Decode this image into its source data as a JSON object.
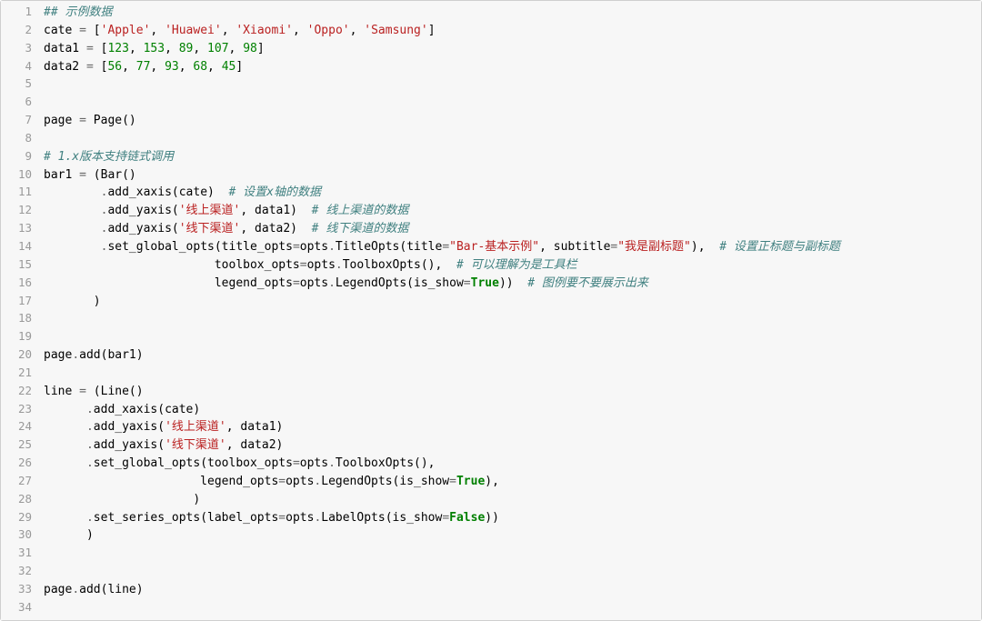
{
  "lines": [
    {
      "n": "1",
      "tokens": [
        {
          "c": "tok-comment",
          "t": "## 示例数据"
        }
      ]
    },
    {
      "n": "2",
      "tokens": [
        {
          "c": "",
          "t": "cate "
        },
        {
          "c": "tok-op",
          "t": "="
        },
        {
          "c": "",
          "t": " ["
        },
        {
          "c": "tok-str",
          "t": "'Apple'"
        },
        {
          "c": "",
          "t": ", "
        },
        {
          "c": "tok-str",
          "t": "'Huawei'"
        },
        {
          "c": "",
          "t": ", "
        },
        {
          "c": "tok-str",
          "t": "'Xiaomi'"
        },
        {
          "c": "",
          "t": ", "
        },
        {
          "c": "tok-str",
          "t": "'Oppo'"
        },
        {
          "c": "",
          "t": ", "
        },
        {
          "c": "tok-str",
          "t": "'Samsung'"
        },
        {
          "c": "",
          "t": "]"
        }
      ]
    },
    {
      "n": "3",
      "tokens": [
        {
          "c": "",
          "t": "data1 "
        },
        {
          "c": "tok-op",
          "t": "="
        },
        {
          "c": "",
          "t": " ["
        },
        {
          "c": "tok-num",
          "t": "123"
        },
        {
          "c": "",
          "t": ", "
        },
        {
          "c": "tok-num",
          "t": "153"
        },
        {
          "c": "",
          "t": ", "
        },
        {
          "c": "tok-num",
          "t": "89"
        },
        {
          "c": "",
          "t": ", "
        },
        {
          "c": "tok-num",
          "t": "107"
        },
        {
          "c": "",
          "t": ", "
        },
        {
          "c": "tok-num",
          "t": "98"
        },
        {
          "c": "",
          "t": "]"
        }
      ]
    },
    {
      "n": "4",
      "tokens": [
        {
          "c": "",
          "t": "data2 "
        },
        {
          "c": "tok-op",
          "t": "="
        },
        {
          "c": "",
          "t": " ["
        },
        {
          "c": "tok-num",
          "t": "56"
        },
        {
          "c": "",
          "t": ", "
        },
        {
          "c": "tok-num",
          "t": "77"
        },
        {
          "c": "",
          "t": ", "
        },
        {
          "c": "tok-num",
          "t": "93"
        },
        {
          "c": "",
          "t": ", "
        },
        {
          "c": "tok-num",
          "t": "68"
        },
        {
          "c": "",
          "t": ", "
        },
        {
          "c": "tok-num",
          "t": "45"
        },
        {
          "c": "",
          "t": "]"
        }
      ]
    },
    {
      "n": "5",
      "tokens": []
    },
    {
      "n": "6",
      "tokens": []
    },
    {
      "n": "7",
      "tokens": [
        {
          "c": "",
          "t": "page "
        },
        {
          "c": "tok-op",
          "t": "="
        },
        {
          "c": "",
          "t": " Page()"
        }
      ]
    },
    {
      "n": "8",
      "tokens": []
    },
    {
      "n": "9",
      "tokens": [
        {
          "c": "tok-comment",
          "t": "# 1.x版本支持链式调用"
        }
      ]
    },
    {
      "n": "10",
      "tokens": [
        {
          "c": "",
          "t": "bar1 "
        },
        {
          "c": "tok-op",
          "t": "="
        },
        {
          "c": "",
          "t": " (Bar()"
        }
      ]
    },
    {
      "n": "11",
      "tokens": [
        {
          "c": "",
          "t": "        "
        },
        {
          "c": "tok-op",
          "t": "."
        },
        {
          "c": "",
          "t": "add_xaxis(cate)  "
        },
        {
          "c": "tok-comment",
          "t": "# 设置x轴的数据"
        }
      ]
    },
    {
      "n": "12",
      "tokens": [
        {
          "c": "",
          "t": "        "
        },
        {
          "c": "tok-op",
          "t": "."
        },
        {
          "c": "",
          "t": "add_yaxis("
        },
        {
          "c": "tok-str",
          "t": "'线上渠道'"
        },
        {
          "c": "",
          "t": ", data1)  "
        },
        {
          "c": "tok-comment",
          "t": "# 线上渠道的数据"
        }
      ]
    },
    {
      "n": "13",
      "tokens": [
        {
          "c": "",
          "t": "        "
        },
        {
          "c": "tok-op",
          "t": "."
        },
        {
          "c": "",
          "t": "add_yaxis("
        },
        {
          "c": "tok-str",
          "t": "'线下渠道'"
        },
        {
          "c": "",
          "t": ", data2)  "
        },
        {
          "c": "tok-comment",
          "t": "# 线下渠道的数据"
        }
      ]
    },
    {
      "n": "14",
      "tokens": [
        {
          "c": "",
          "t": "        "
        },
        {
          "c": "tok-op",
          "t": "."
        },
        {
          "c": "",
          "t": "set_global_opts(title_opts"
        },
        {
          "c": "tok-op",
          "t": "="
        },
        {
          "c": "",
          "t": "opts"
        },
        {
          "c": "tok-op",
          "t": "."
        },
        {
          "c": "",
          "t": "TitleOpts(title"
        },
        {
          "c": "tok-op",
          "t": "="
        },
        {
          "c": "tok-str",
          "t": "\"Bar-基本示例\""
        },
        {
          "c": "",
          "t": ", subtitle"
        },
        {
          "c": "tok-op",
          "t": "="
        },
        {
          "c": "tok-str",
          "t": "\"我是副标题\""
        },
        {
          "c": "",
          "t": "),  "
        },
        {
          "c": "tok-comment",
          "t": "# 设置正标题与副标题"
        }
      ]
    },
    {
      "n": "15",
      "tokens": [
        {
          "c": "",
          "t": "                        toolbox_opts"
        },
        {
          "c": "tok-op",
          "t": "="
        },
        {
          "c": "",
          "t": "opts"
        },
        {
          "c": "tok-op",
          "t": "."
        },
        {
          "c": "",
          "t": "ToolboxOpts(),  "
        },
        {
          "c": "tok-comment",
          "t": "# 可以理解为是工具栏"
        }
      ]
    },
    {
      "n": "16",
      "tokens": [
        {
          "c": "",
          "t": "                        legend_opts"
        },
        {
          "c": "tok-op",
          "t": "="
        },
        {
          "c": "",
          "t": "opts"
        },
        {
          "c": "tok-op",
          "t": "."
        },
        {
          "c": "",
          "t": "LegendOpts(is_show"
        },
        {
          "c": "tok-op",
          "t": "="
        },
        {
          "c": "tok-kw",
          "t": "True"
        },
        {
          "c": "",
          "t": "))  "
        },
        {
          "c": "tok-comment",
          "t": "# 图例要不要展示出来"
        }
      ]
    },
    {
      "n": "17",
      "tokens": [
        {
          "c": "",
          "t": "       )"
        }
      ]
    },
    {
      "n": "18",
      "tokens": []
    },
    {
      "n": "19",
      "tokens": []
    },
    {
      "n": "20",
      "tokens": [
        {
          "c": "",
          "t": "page"
        },
        {
          "c": "tok-op",
          "t": "."
        },
        {
          "c": "",
          "t": "add(bar1)"
        }
      ]
    },
    {
      "n": "21",
      "tokens": []
    },
    {
      "n": "22",
      "tokens": [
        {
          "c": "",
          "t": "line "
        },
        {
          "c": "tok-op",
          "t": "="
        },
        {
          "c": "",
          "t": " (Line()"
        }
      ]
    },
    {
      "n": "23",
      "tokens": [
        {
          "c": "",
          "t": "      "
        },
        {
          "c": "tok-op",
          "t": "."
        },
        {
          "c": "",
          "t": "add_xaxis(cate)"
        }
      ]
    },
    {
      "n": "24",
      "tokens": [
        {
          "c": "",
          "t": "      "
        },
        {
          "c": "tok-op",
          "t": "."
        },
        {
          "c": "",
          "t": "add_yaxis("
        },
        {
          "c": "tok-str",
          "t": "'线上渠道'"
        },
        {
          "c": "",
          "t": ", data1)"
        }
      ]
    },
    {
      "n": "25",
      "tokens": [
        {
          "c": "",
          "t": "      "
        },
        {
          "c": "tok-op",
          "t": "."
        },
        {
          "c": "",
          "t": "add_yaxis("
        },
        {
          "c": "tok-str",
          "t": "'线下渠道'"
        },
        {
          "c": "",
          "t": ", data2)"
        }
      ]
    },
    {
      "n": "26",
      "tokens": [
        {
          "c": "",
          "t": "      "
        },
        {
          "c": "tok-op",
          "t": "."
        },
        {
          "c": "",
          "t": "set_global_opts(toolbox_opts"
        },
        {
          "c": "tok-op",
          "t": "="
        },
        {
          "c": "",
          "t": "opts"
        },
        {
          "c": "tok-op",
          "t": "."
        },
        {
          "c": "",
          "t": "ToolboxOpts(),"
        }
      ]
    },
    {
      "n": "27",
      "tokens": [
        {
          "c": "",
          "t": "                      legend_opts"
        },
        {
          "c": "tok-op",
          "t": "="
        },
        {
          "c": "",
          "t": "opts"
        },
        {
          "c": "tok-op",
          "t": "."
        },
        {
          "c": "",
          "t": "LegendOpts(is_show"
        },
        {
          "c": "tok-op",
          "t": "="
        },
        {
          "c": "tok-kw",
          "t": "True"
        },
        {
          "c": "",
          "t": "),"
        }
      ]
    },
    {
      "n": "28",
      "tokens": [
        {
          "c": "",
          "t": "                     )"
        }
      ]
    },
    {
      "n": "29",
      "tokens": [
        {
          "c": "",
          "t": "      "
        },
        {
          "c": "tok-op",
          "t": "."
        },
        {
          "c": "",
          "t": "set_series_opts(label_opts"
        },
        {
          "c": "tok-op",
          "t": "="
        },
        {
          "c": "",
          "t": "opts"
        },
        {
          "c": "tok-op",
          "t": "."
        },
        {
          "c": "",
          "t": "LabelOpts(is_show"
        },
        {
          "c": "tok-op",
          "t": "="
        },
        {
          "c": "tok-kw",
          "t": "False"
        },
        {
          "c": "",
          "t": "))"
        }
      ]
    },
    {
      "n": "30",
      "tokens": [
        {
          "c": "",
          "t": "      )"
        }
      ]
    },
    {
      "n": "31",
      "tokens": []
    },
    {
      "n": "32",
      "tokens": []
    },
    {
      "n": "33",
      "tokens": [
        {
          "c": "",
          "t": "page"
        },
        {
          "c": "tok-op",
          "t": "."
        },
        {
          "c": "",
          "t": "add(line)"
        }
      ]
    },
    {
      "n": "34",
      "tokens": []
    }
  ]
}
